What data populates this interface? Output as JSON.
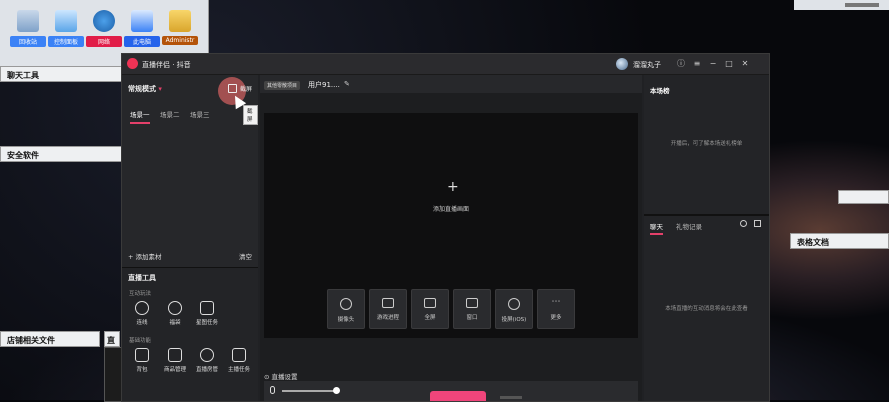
{
  "desktop": {
    "icons": [
      {
        "label": "回收站",
        "icon": "recycle-bin-icon",
        "color": "#3b82f6"
      },
      {
        "label": "控制面板",
        "icon": "control-panel-icon",
        "color": "#3b82f6"
      },
      {
        "label": "网络",
        "icon": "network-icon",
        "color": "#e11d48"
      },
      {
        "label": "此电脑",
        "icon": "computer-icon",
        "color": "#2563eb"
      },
      {
        "label": "Administr",
        "icon": "folder-icon",
        "color": "#b45309"
      }
    ],
    "panels": {
      "chat_tools": "聊天工具",
      "security": "安全软件",
      "shop_files": "店铺相关文件",
      "right_label": "表格文档",
      "tiny_label": "直"
    }
  },
  "app": {
    "title": "直播伴侣 · 抖音",
    "user": "溜溜丸子",
    "mode": "常规模式",
    "crop_label": "截屏",
    "tooltip": "截屏",
    "scenes": [
      "场景一",
      "场景二",
      "场景三"
    ],
    "add_material": "+ 添加素材",
    "clear": "清空",
    "tools_title": "直播工具",
    "group_interactive": "互动玩法",
    "group_basic": "基础功能",
    "tools_row1": [
      {
        "label": "连线",
        "icon": "link-icon"
      },
      {
        "label": "福袋",
        "icon": "lucky-bag-icon"
      },
      {
        "label": "星图任务",
        "icon": "star-task-icon"
      }
    ],
    "tools_row2": [
      {
        "label": "背包",
        "icon": "backpack-icon"
      },
      {
        "label": "商品管理",
        "icon": "shop-icon"
      },
      {
        "label": "直播房管",
        "icon": "room-admin-icon"
      },
      {
        "label": "主播任务",
        "icon": "task-icon"
      }
    ],
    "room_chip": "其他零散项目",
    "room_user": "用户91....",
    "add_screen": "添加直播画面",
    "sources": [
      {
        "label": "摄像头",
        "icon": "camera-icon"
      },
      {
        "label": "游戏进程",
        "icon": "gamepad-icon"
      },
      {
        "label": "全屏",
        "icon": "monitor-icon"
      },
      {
        "label": "窗口",
        "icon": "window-icon"
      },
      {
        "label": "投屏(iOS)",
        "icon": "apple-icon"
      },
      {
        "label": "更多",
        "icon": "more-icon"
      }
    ],
    "live_settings": "⊙ 直播设置",
    "audience_title": "本场榜",
    "audience_msg": "开播后，可了解本场送礼榜单",
    "chat_tab": "聊天",
    "gift_tab": "礼物记录",
    "chat_msg": "本场直播的互动消息将会在此查看",
    "accent": "#e4406a",
    "golive_color": "#f0457b",
    "volume_level": 0.9
  }
}
